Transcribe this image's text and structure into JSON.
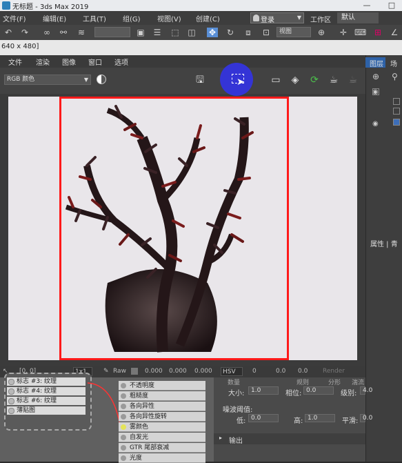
{
  "window": {
    "title": "无标题 - 3ds Max 2019",
    "controls": [
      "—",
      "□"
    ]
  },
  "menubar": {
    "items": [
      "文件(F)",
      "编辑(E)",
      "工具(T)",
      "组(G)",
      "视图(V)",
      "创建(C)"
    ],
    "login": "登录",
    "workspace_label": "工作区",
    "workspace_value": "默认"
  },
  "toolbar": {
    "view_dropdown": "视图"
  },
  "info": {
    "resolution": "640 x 480]"
  },
  "frame_window": {
    "menu": [
      "文件",
      "渲染",
      "图像",
      "窗口",
      "选项"
    ],
    "channel": "RGB 颜色",
    "status": {
      "coords": "[0, 0]",
      "zoom": "1x1",
      "mode": "Raw",
      "r": "0.000",
      "g": "0.000",
      "b": "0.000",
      "color_space": "HSV",
      "h": "0",
      "s": "0.0",
      "v": "0.0",
      "render": "Render"
    }
  },
  "right_panel": {
    "tabs": [
      "图层",
      "场"
    ],
    "section": "属性 | 青"
  },
  "node_editor": {
    "map_rows": [
      "标志 #3: 纹理",
      "标志 #4: 纹理",
      "标志 #6: 纹理",
      "薄贴图"
    ],
    "material_rows": [
      "不透明度",
      "粗糙度",
      "各向异性",
      "各向异性旋转",
      "雾颜色",
      "自发光",
      "GTR 尾部衰减",
      "光度"
    ],
    "active_row": "雾颜色"
  },
  "properties": {
    "row1": {
      "label_a": "数量",
      "label_b": "规则",
      "label_c": "分形",
      "label_d": "湍流"
    },
    "size_label": "大小:",
    "size_value": "1.0",
    "phase_label": "相位:",
    "phase_value": "0.0",
    "level_label": "级别:",
    "level_value": "4.0",
    "threshold_label": "噪波阈值:",
    "low_label": "低:",
    "low_value": "0.0",
    "high_label": "高:",
    "high_value": "1.0",
    "smooth_label": "平滑:",
    "smooth_value": "0.0",
    "output_label": "输出"
  }
}
